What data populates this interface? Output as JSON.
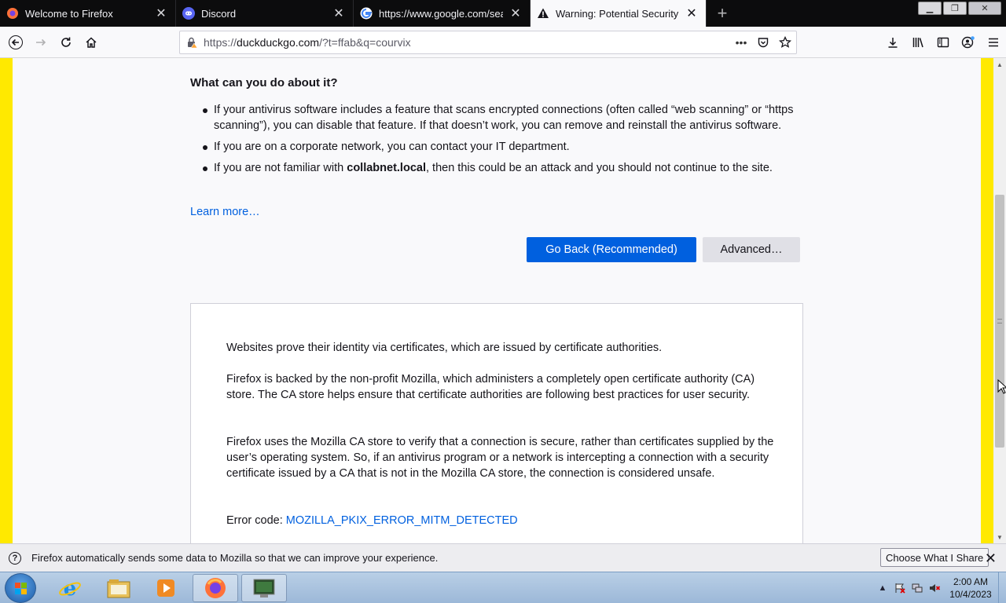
{
  "tabs": [
    {
      "title": "Welcome to Firefox",
      "icon": "firefox-icon"
    },
    {
      "title": "Discord",
      "icon": "discord-icon"
    },
    {
      "title": "https://www.google.com/sear",
      "icon": "google-icon"
    },
    {
      "title": "Warning: Potential Security Ris",
      "icon": "warning-icon",
      "active": true
    }
  ],
  "url": {
    "prefix": "https://",
    "host": "duckduckgo.com",
    "rest": "/?t=ffab&q=courvix"
  },
  "page": {
    "heading": "What can you do about it?",
    "bullets": {
      "b1": "If your antivirus software includes a feature that scans encrypted connections (often called “web scanning” or “https scanning”), you can disable that feature. If that doesn’t work, you can remove and reinstall the antivirus software.",
      "b2": "If you are on a corporate network, you can contact your IT department.",
      "b3_pre": "If you are not familiar with ",
      "b3_host": "collabnet.local",
      "b3_post": ", then this could be an attack and you should not continue to the site."
    },
    "learn_more": "Learn more…",
    "go_back": "Go Back (Recommended)",
    "advanced": "Advanced…",
    "advanced_box": {
      "p1": "Websites prove their identity via certificates, which are issued by certificate authorities.",
      "p2": "Firefox is backed by the non-profit Mozilla, which administers a completely open certificate authority (CA) store. The CA store helps ensure that certificate authorities are following best practices for user security.",
      "p3": "Firefox uses the Mozilla CA store to verify that a connection is secure, rather than certificates supplied by the user’s operating system. So, if an antivirus program or a network is intercepting a connection with a security certificate issued by a CA that is not in the Mozilla CA store, the connection is considered unsafe.",
      "error_label": "Error code: ",
      "error_code": "MOZILLA_PKIX_ERROR_MITM_DETECTED"
    }
  },
  "notification": {
    "text": "Firefox automatically sends some data to Mozilla so that we can improve your experience.",
    "button": "Choose What I Share"
  },
  "taskbar": {
    "time": "2:00 AM",
    "date": "10/4/2023"
  },
  "colors": {
    "accent": "#0060df",
    "stripe": "#ffe900"
  }
}
